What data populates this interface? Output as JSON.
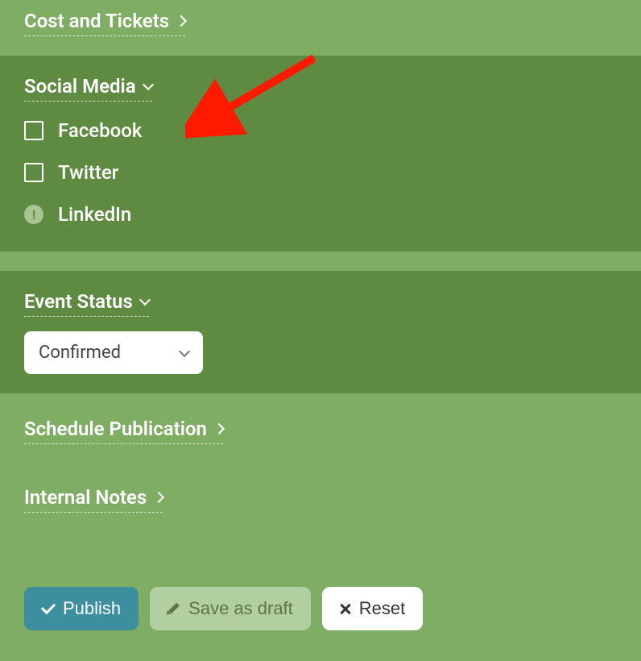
{
  "sections": {
    "cost_tickets": {
      "title": "Cost and Tickets"
    },
    "social_media": {
      "title": "Social Media",
      "options": {
        "facebook": "Facebook",
        "twitter": "Twitter",
        "linkedin": "LinkedIn"
      }
    },
    "event_status": {
      "title": "Event Status",
      "selected": "Confirmed"
    },
    "schedule_publication": {
      "title": "Schedule Publication"
    },
    "internal_notes": {
      "title": "Internal Notes"
    }
  },
  "buttons": {
    "publish": "Publish",
    "save_draft": "Save as draft",
    "reset": "Reset"
  },
  "annotation": {
    "arrow_color": "#ff1a00"
  }
}
